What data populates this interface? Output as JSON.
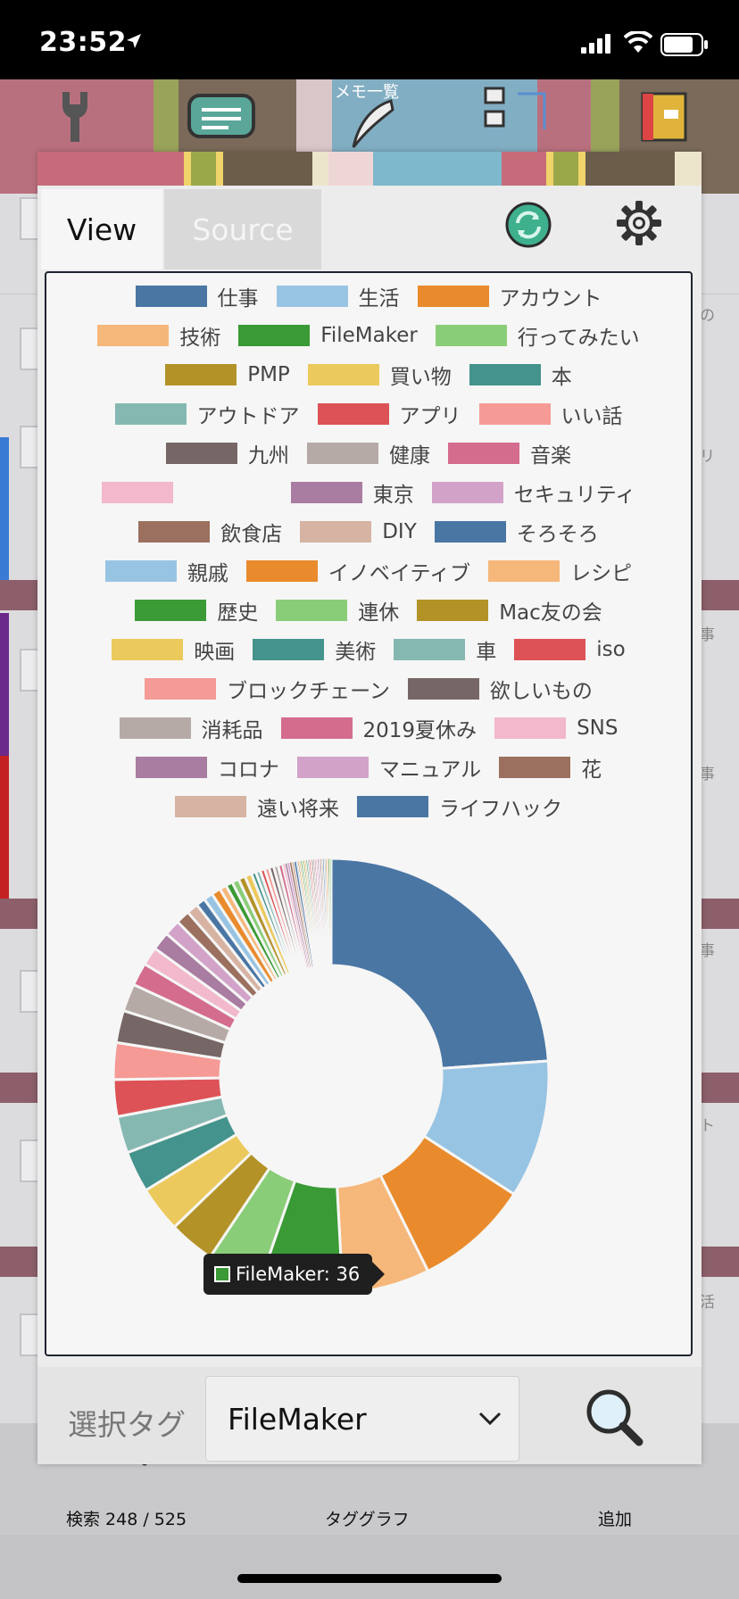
{
  "status_bar": {
    "time": "23:52"
  },
  "toolbar": {
    "title": "メモ一覧"
  },
  "background_list": {
    "snippets": [
      "の",
      "リ",
      "事",
      "事",
      "事",
      "ト",
      "活"
    ]
  },
  "bottom_tabs": [
    {
      "label": "検索 248 / 525"
    },
    {
      "label": "タググラフ"
    },
    {
      "label": "追加"
    }
  ],
  "popup": {
    "tabs": {
      "view": "View",
      "source": "Source"
    },
    "footer": {
      "label": "選択タグ",
      "selected_value": "FileMaker"
    }
  },
  "tooltip": {
    "text": "FileMaker: 36",
    "color": "#3a9a35"
  },
  "chart_data": {
    "type": "pie",
    "donut": true,
    "legend_position": "top",
    "tags": [
      {
        "name": "仕事",
        "value": 140,
        "color": "#4a76a4"
      },
      {
        "name": "生活",
        "value": 60,
        "color": "#98c4e3"
      },
      {
        "name": "アカウント",
        "value": 50,
        "color": "#e98b2d"
      },
      {
        "name": "技術",
        "value": 38,
        "color": "#f6b77a"
      },
      {
        "name": "FileMaker",
        "value": 36,
        "color": "#3a9a35"
      },
      {
        "name": "行ってみたい",
        "value": 24,
        "color": "#8acd78"
      },
      {
        "name": "PMP",
        "value": 20,
        "color": "#b39228"
      },
      {
        "name": "買い物",
        "value": 20,
        "color": "#ebc95c"
      },
      {
        "name": "本",
        "value": 18,
        "color": "#44938c"
      },
      {
        "name": "アウトドア",
        "value": 16,
        "color": "#86b8b2"
      },
      {
        "name": "アプリ",
        "value": 16,
        "color": "#dd5256"
      },
      {
        "name": "いい話",
        "value": 16,
        "color": "#f59a95"
      },
      {
        "name": "九州",
        "value": 14,
        "color": "#766766"
      },
      {
        "name": "健康",
        "value": 12,
        "color": "#b6aaa6"
      },
      {
        "name": "音楽",
        "value": 10,
        "color": "#d46c8e"
      },
      {
        "name": "",
        "value": 8,
        "color": "#f2b8cc"
      },
      {
        "name": "東京",
        "value": 8,
        "color": "#a97ca1"
      },
      {
        "name": "セキュリティ",
        "value": 7,
        "color": "#d2a2c9"
      },
      {
        "name": "飲食店",
        "value": 6,
        "color": "#9b705e"
      },
      {
        "name": "DIY",
        "value": 5,
        "color": "#d7b3a3"
      },
      {
        "name": "そろそろ",
        "value": 4,
        "color": "#4a76a4"
      },
      {
        "name": "親戚",
        "value": 4,
        "color": "#98c4e3"
      },
      {
        "name": "イノベイティブ",
        "value": 4,
        "color": "#e98b2d"
      },
      {
        "name": "レシピ",
        "value": 3,
        "color": "#f6b77a"
      },
      {
        "name": "歴史",
        "value": 3,
        "color": "#3a9a35"
      },
      {
        "name": "連休",
        "value": 3,
        "color": "#8acd78"
      },
      {
        "name": "Mac友の会",
        "value": 3,
        "color": "#b39228"
      },
      {
        "name": "映画",
        "value": 3,
        "color": "#ebc95c"
      },
      {
        "name": "美術",
        "value": 2,
        "color": "#44938c"
      },
      {
        "name": "車",
        "value": 2,
        "color": "#86b8b2"
      },
      {
        "name": "iso",
        "value": 2,
        "color": "#dd5256"
      },
      {
        "name": "ブロックチェーン",
        "value": 2,
        "color": "#f59a95"
      },
      {
        "name": "欲しいもの",
        "value": 2,
        "color": "#766766"
      },
      {
        "name": "消耗品",
        "value": 2,
        "color": "#b6aaa6"
      },
      {
        "name": "2019夏休み",
        "value": 2,
        "color": "#d46c8e"
      },
      {
        "name": "SNS",
        "value": 1,
        "color": "#f2b8cc"
      },
      {
        "name": "コロナ",
        "value": 1,
        "color": "#a97ca1"
      },
      {
        "name": "マニュアル",
        "value": 1,
        "color": "#d2a2c9"
      },
      {
        "name": "花",
        "value": 1,
        "color": "#9b705e"
      },
      {
        "name": "遠い将来",
        "value": 1,
        "color": "#d7b3a3"
      },
      {
        "name": "ライフハック",
        "value": 1,
        "color": "#4a76a4"
      }
    ],
    "unlisted_colors": [
      "#98c4e3",
      "#e98b2d",
      "#f6b77a",
      "#3a9a35",
      "#8acd78",
      "#b39228",
      "#ebc95c",
      "#44938c",
      "#86b8b2",
      "#dd5256",
      "#f59a95",
      "#766766",
      "#b6aaa6",
      "#d46c8e",
      "#f2b8cc",
      "#a97ca1",
      "#d2a2c9",
      "#9b705e",
      "#d7b3a3",
      "#4a76a4",
      "#98c4e3",
      "#e98b2d",
      "#f6b77a",
      "#3a9a35",
      "#8acd78"
    ]
  }
}
